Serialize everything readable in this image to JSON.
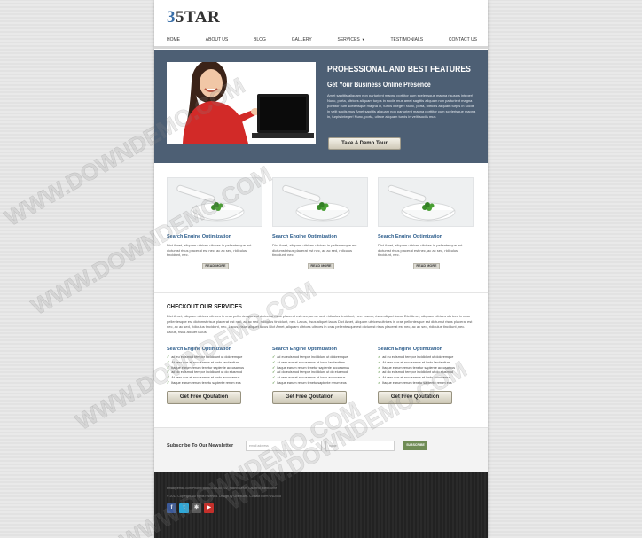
{
  "brand": {
    "logo_prefix": "3",
    "logo_rest": "5TAR"
  },
  "nav": {
    "items": [
      {
        "label": "Home"
      },
      {
        "label": "About Us"
      },
      {
        "label": "Blog"
      },
      {
        "label": "Gallery"
      },
      {
        "label": "Services",
        "has_caret": true
      },
      {
        "label": "Testimonials"
      },
      {
        "label": "Contact Us"
      }
    ]
  },
  "hero": {
    "title": "PROFESSIONAL AND BEST FEATURES",
    "subtitle": "Get Your Business Online Presence",
    "text": "Amet sagittis aliquam non parturient magna porttitor cum scelerisque magna risuspis integer! Nunc, porta, ultrices aliquam turpis in sociis mus amet sagittis aliquam non parturient magna porttitor cum scelerisque magna in, turpis integer! Nunc, porta, ultrices aliquam turpis in sociis in velit sociis mus Amet sagittis aliquam non parturient magna porttitor cum scelerisque magna in, turpis integer! Nunc, porta, ultrice aliquam turpis in velit sociis mus",
    "cta_label": "Take A Demo Tour"
  },
  "features": [
    {
      "title": "Search Engine Optimization",
      "text": "Dict Amet, aliquam ultrices ultrices in pellentesque est dictumst risus placerat est nec, ac ac sed, ridiculus tincidunt, nec.",
      "button": "READ MORE"
    },
    {
      "title": "Search Engine Optimization",
      "text": "Dict Amet, aliquam ultrices ultrices in pellentesque est dictumst risus placerat est nec, ac ac sed, ridiculus tincidunt, nec.",
      "button": "READ MORE"
    },
    {
      "title": "Search Engine Optimization",
      "text": "Dict Amet, aliquam ultrices ultrices in pellentesque est dictumst risus placerat est nec, ac ac sed, ridiculus tincidunt, nec.",
      "button": "READ MORE"
    }
  ],
  "services": {
    "title": "CHECKOUT OUR SERVICES",
    "intro": "Dict Amet, aliquam ultrices ultrices in cras pellentesque est dictumst risus placerat est nec, ac ac sed, ridiculus tincidunt, nec. Lacus, risus aliquet lacus Dict Amet, aliquam ultrices ultrices in cras pellentesque est dictumst risus placerat est nec, ac ac sed, ridiculus tincidunt, nec. Lacus, risus aliquet lacus Dict Amet, aliquam ultrices ultrices in cras pellentesque est dictumst risus placerat est nec, ac ac sed, ridiculus tincidunt, nec. Lacus, risus aliquet lacus Dict Amet, aliquam ultrices ultrices in cras pellentesque est dictumst risus placerat est nec, ac ac sed, ridiculus tincidunt, nec. Lacus, risus aliquet lacus.",
    "columns": [
      {
        "title": "Search Engine Optimization",
        "items": [
          "ad eu euismod tempor incididunt ut doloremque",
          "At vero eos et accusamus et iusto laudantium",
          "Itaque earum rerum tenetur sapiente accusamus",
          "ad do euismod tempor incididunt ut do eiusmod",
          "At vero eos et accusamus et iusto accusamus",
          "Itaque earum rerum tenetu sapiente rerum eos"
        ],
        "button": "Get Free Qoutation"
      },
      {
        "title": "Search Engine Optimization",
        "items": [
          "ad eu euismod tempor incididunt ut doloremque",
          "At vero eos et accusamus et iusto laudantium",
          "Itaque earum rerum tenetur sapiente accusamus",
          "ad do euismod tempor incididunt ut do eiusmod",
          "At vero eos et accusamus et iusto accusamus",
          "Itaque earum rerum tenetu sapiente rerum eos"
        ],
        "button": "Get Free Qoutation"
      },
      {
        "title": "Search Engine Optimization",
        "items": [
          "ad eu euismod tempor incididunt ut doloremque",
          "At vero eos et accusamus et iusto laudantium",
          "Itaque earum rerum tenetur sapiente accusamus",
          "ad do euismod tempor incididunt ut do eiusmod",
          "At vero eos et accusamus et iusto accusamus",
          "Itaque earum rerum tenetu sapiente rerum eos"
        ],
        "button": "Get Free Qoutation"
      }
    ]
  },
  "newsletter": {
    "label": "Subscribe To Our Newsletter",
    "email_placeholder": "email address",
    "name_placeholder": "name",
    "button": "SUBSCRIBE"
  },
  "footer": {
    "contact_line": "email@email.com  Phone: 00-000-00-00    202, Pilkhni Drive, Caulfield, Melbourne",
    "copyright_line": "© 2013 Copyright. All rights reserved. Design by Grafxsarr - Contact Form WD2008",
    "social": [
      {
        "name": "facebook-icon",
        "glyph": "f",
        "color": "#3b5998"
      },
      {
        "name": "twitter-icon",
        "glyph": "t",
        "color": "#2fa8d8"
      },
      {
        "name": "flickr-icon",
        "glyph": "✱",
        "color": "#5a5a5a"
      },
      {
        "name": "youtube-icon",
        "glyph": "▶",
        "color": "#c4302b"
      }
    ]
  },
  "watermark": "WWW.DOWNDEMO.COM",
  "colors": {
    "hero_bg": "#4d5f74",
    "accent": "#2f5f8d",
    "subscribe": "#6f8c55",
    "footer_bg": "#262626"
  }
}
